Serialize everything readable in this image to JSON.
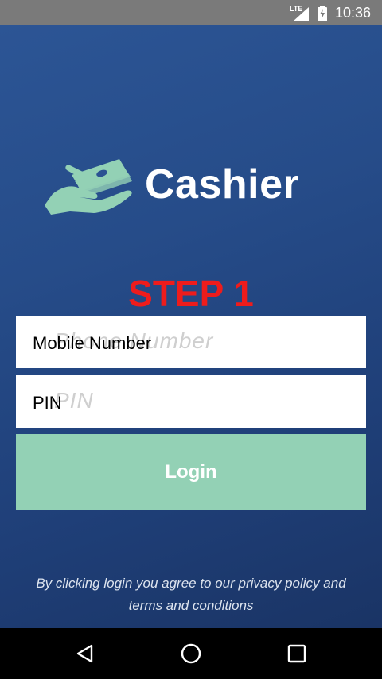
{
  "status_bar": {
    "network_label": "LTE",
    "time": "10:36"
  },
  "app": {
    "brand_name": "Cashier",
    "step_title": "STEP 1",
    "phone_field": {
      "placeholder": "Phone Number",
      "value": "Mobile Number"
    },
    "pin_field": {
      "placeholder": "PIN",
      "value": "PIN"
    },
    "login_label": "Login",
    "terms_text": "By clicking login you agree to our privacy policy and terms and conditions"
  },
  "colors": {
    "background": "#2a5292",
    "accent_green": "#93d1b5",
    "step_red": "#ee1c1c"
  },
  "icons": [
    "signal-icon",
    "battery-icon",
    "hand-money-logo-icon",
    "back-icon",
    "home-icon",
    "recent-apps-icon"
  ]
}
